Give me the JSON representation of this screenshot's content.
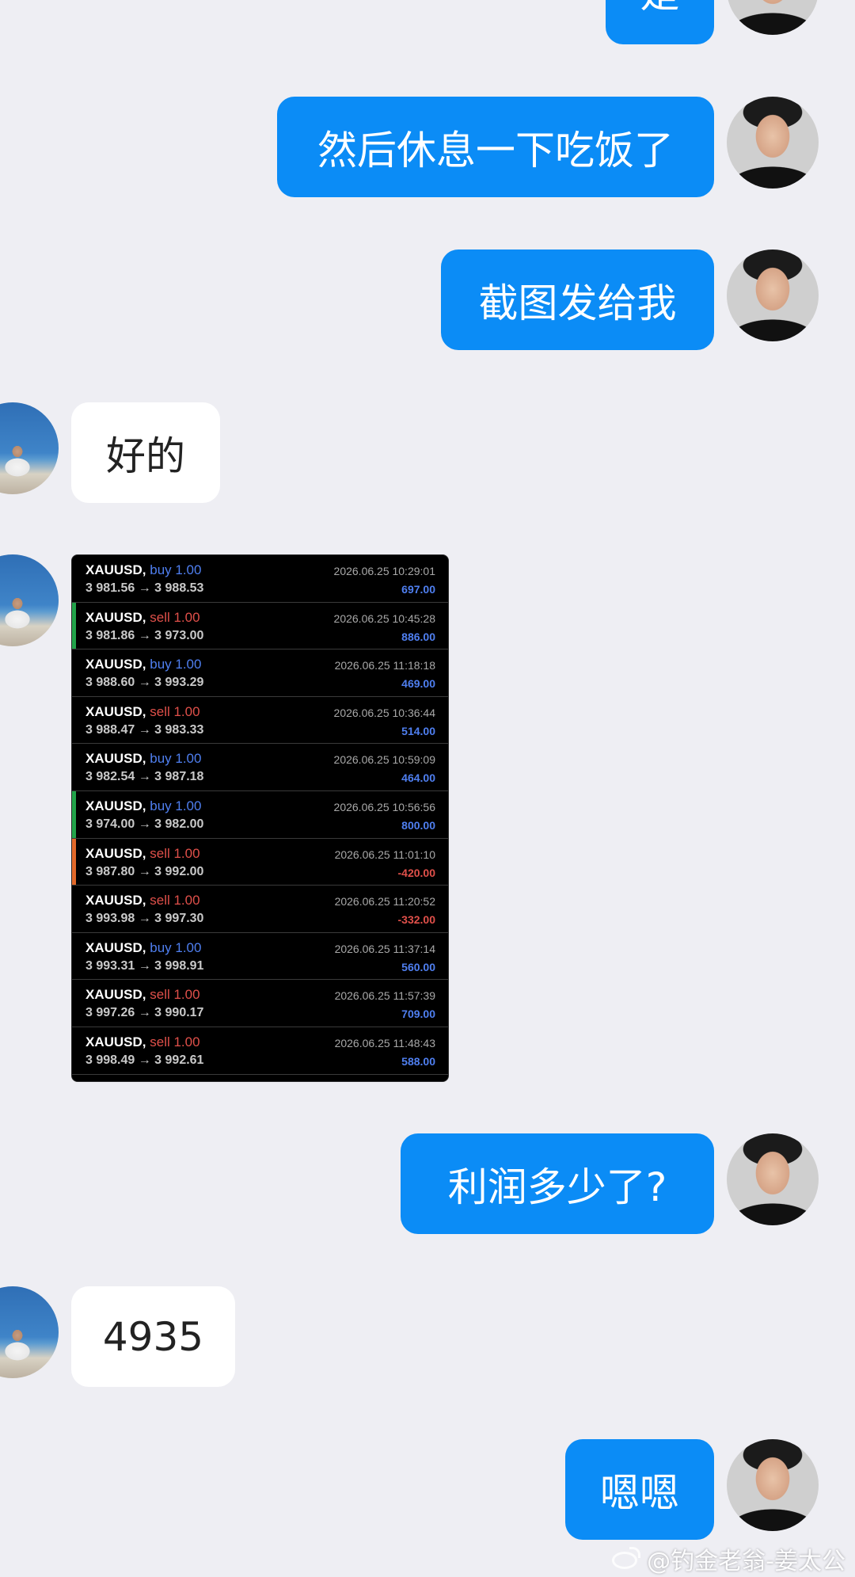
{
  "messages": [
    {
      "from": "me",
      "text": "是"
    },
    {
      "from": "me",
      "text": "然后休息一下吃饭了"
    },
    {
      "from": "me",
      "text": "截图发给我"
    },
    {
      "from": "other",
      "text": "好的"
    },
    {
      "from": "other",
      "type": "image",
      "description": "trade-history-screenshot"
    },
    {
      "from": "me",
      "text": "利润多少了?"
    },
    {
      "from": "other",
      "text": "4935"
    },
    {
      "from": "me",
      "text": "嗯嗯"
    }
  ],
  "trades": [
    {
      "symbol": "XAUUSD,",
      "side": "buy 1.00",
      "direction": "buy",
      "prices": "3 981.56 → 3 988.53",
      "time": "2026.06.25 10:29:01",
      "profit": "697.00",
      "edge": ""
    },
    {
      "symbol": "XAUUSD,",
      "side": "sell 1.00",
      "direction": "sell",
      "prices": "3 981.86 → 3 973.00",
      "time": "2026.06.25 10:45:28",
      "profit": "886.00",
      "edge": "#22a34a"
    },
    {
      "symbol": "XAUUSD,",
      "side": "buy 1.00",
      "direction": "buy",
      "prices": "3 988.60 → 3 993.29",
      "time": "2026.06.25 11:18:18",
      "profit": "469.00",
      "edge": ""
    },
    {
      "symbol": "XAUUSD,",
      "side": "sell 1.00",
      "direction": "sell",
      "prices": "3 988.47 → 3 983.33",
      "time": "2026.06.25 10:36:44",
      "profit": "514.00",
      "edge": ""
    },
    {
      "symbol": "XAUUSD,",
      "side": "buy 1.00",
      "direction": "buy",
      "prices": "3 982.54 → 3 987.18",
      "time": "2026.06.25 10:59:09",
      "profit": "464.00",
      "edge": ""
    },
    {
      "symbol": "XAUUSD,",
      "side": "buy 1.00",
      "direction": "buy",
      "prices": "3 974.00 → 3 982.00",
      "time": "2026.06.25 10:56:56",
      "profit": "800.00",
      "edge": "#22a34a"
    },
    {
      "symbol": "XAUUSD,",
      "side": "sell 1.00",
      "direction": "sell",
      "prices": "3 987.80 → 3 992.00",
      "time": "2026.06.25 11:01:10",
      "profit": "-420.00",
      "edge": "#e2692a"
    },
    {
      "symbol": "XAUUSD,",
      "side": "sell 1.00",
      "direction": "sell",
      "prices": "3 993.98 → 3 997.30",
      "time": "2026.06.25 11:20:52",
      "profit": "-332.00",
      "edge": ""
    },
    {
      "symbol": "XAUUSD,",
      "side": "buy 1.00",
      "direction": "buy",
      "prices": "3 993.31 → 3 998.91",
      "time": "2026.06.25 11:37:14",
      "profit": "560.00",
      "edge": ""
    },
    {
      "symbol": "XAUUSD,",
      "side": "sell 1.00",
      "direction": "sell",
      "prices": "3 997.26 → 3 990.17",
      "time": "2026.06.25 11:57:39",
      "profit": "709.00",
      "edge": ""
    },
    {
      "symbol": "XAUUSD,",
      "side": "sell 1.00",
      "direction": "sell",
      "prices": "3 998.49 → 3 992.61",
      "time": "2026.06.25 11:48:43",
      "profit": "588.00",
      "edge": ""
    }
  ],
  "watermark": "@钓金老翁-姜太公",
  "colors": {
    "background": "#eeeef3",
    "my_bubble": "#0b8cf6",
    "other_bubble": "#ffffff",
    "buy": "#4f7ff0",
    "sell": "#e0504a"
  }
}
